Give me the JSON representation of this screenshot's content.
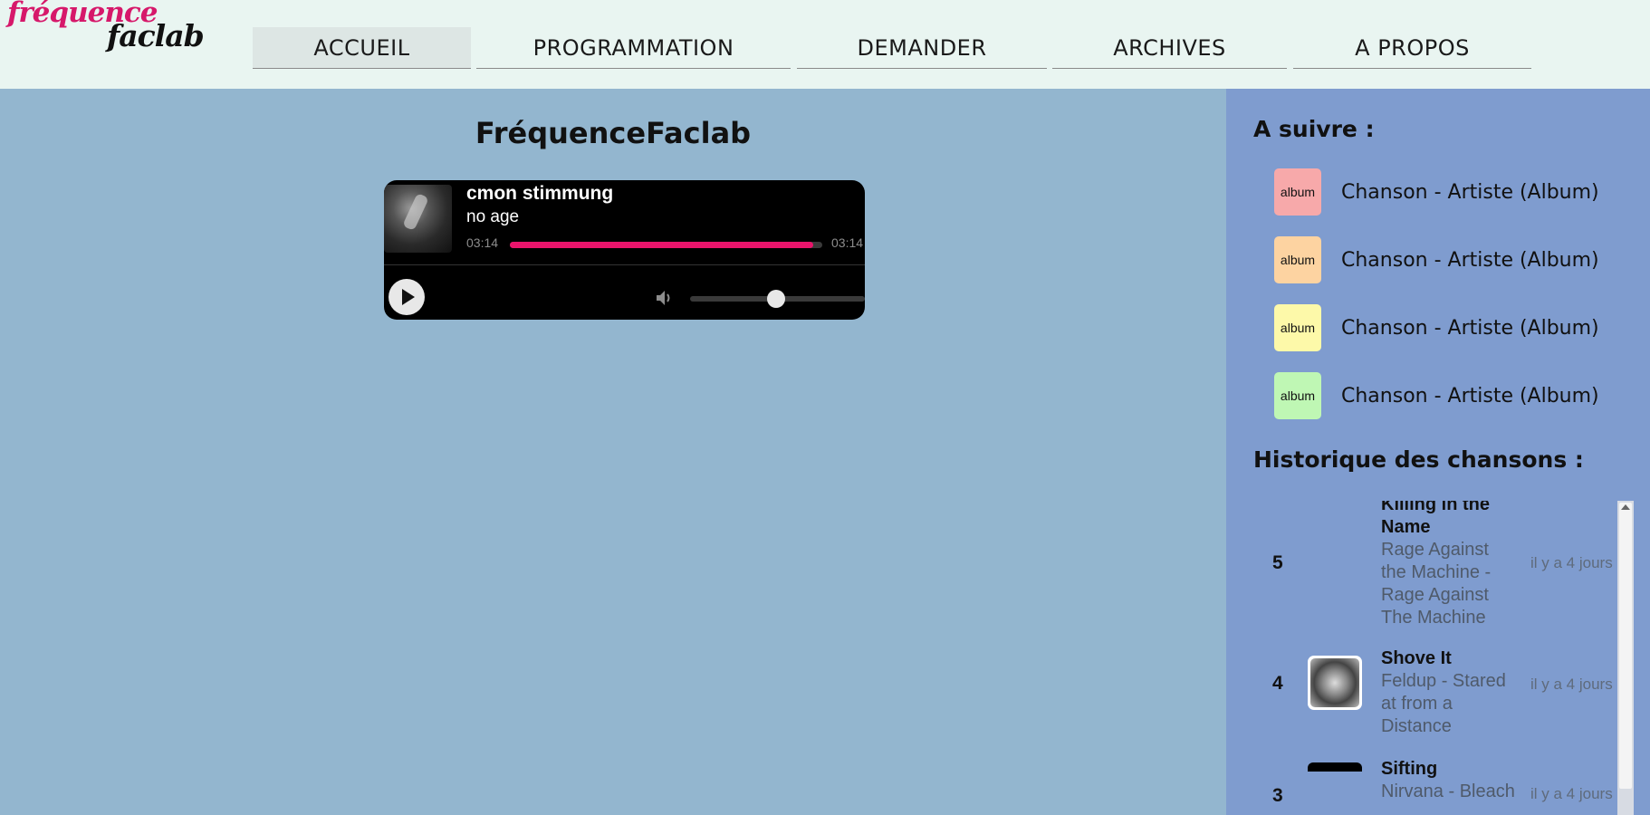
{
  "header": {
    "logo_line1": "fréquence",
    "logo_line2": "faclab",
    "nav": [
      {
        "label": "ACCUEIL"
      },
      {
        "label": "PROGRAMMATION"
      },
      {
        "label": "DEMANDER"
      },
      {
        "label": "ARCHIVES"
      },
      {
        "label": "A PROPOS"
      }
    ],
    "active_nav": "ACCUEIL"
  },
  "main": {
    "title": "FréquenceFaclab"
  },
  "player": {
    "song": "cmon stimmung",
    "artist": "no age",
    "elapsed": "03:14",
    "total": "03:14",
    "progress": 0.97,
    "volume": 0.49,
    "accent": "#e9146b"
  },
  "sidebar": {
    "up_next_title": "A suivre :",
    "queue": [
      {
        "album": "album",
        "text": "Chanson - Artiste (Album)",
        "color": "#f7a9aa"
      },
      {
        "album": "album",
        "text": "Chanson - Artiste (Album)",
        "color": "#fdd3a1"
      },
      {
        "album": "album",
        "text": "Chanson - Artiste (Album)",
        "color": "#fdf9a9"
      },
      {
        "album": "album",
        "text": "Chanson - Artiste (Album)",
        "color": "#bff7b4"
      }
    ],
    "history_title": "Historique des chansons :",
    "history": [
      {
        "num": "5",
        "title": "Killing in the Name",
        "subtitle": "Rage Against the Machine - Rage Against The Machine",
        "time": "il y a 4 jours"
      },
      {
        "num": "4",
        "title": "Shove It",
        "subtitle": "Feldup - Stared at from a Distance",
        "time": "il y a 4 jours"
      },
      {
        "num": "3",
        "title": "Sifting",
        "subtitle": "Nirvana - Bleach",
        "time": "il y a 4 jours"
      }
    ]
  },
  "colors": {
    "header_bg": "#e9f5f1",
    "main_bg": "#93b6cf",
    "sidebar_bg": "#7f9ccf",
    "logo_pink": "#d6186a"
  }
}
